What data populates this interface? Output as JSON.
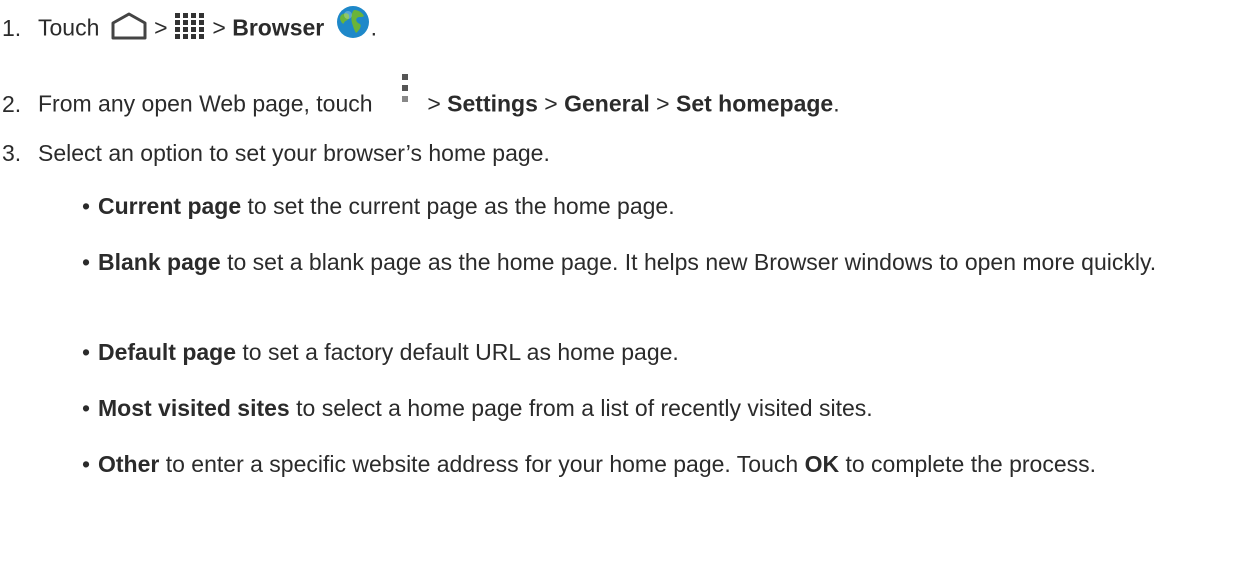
{
  "colors": {
    "text": "#2b2b2b",
    "icon_gray": "#444444",
    "globe_blue": "#1e88c9",
    "globe_green": "#6ab43a"
  },
  "icons": {
    "home": "home-outline-icon",
    "apps": "apps-grid-icon",
    "browser": "globe-icon",
    "menu": "overflow-menu-icon"
  },
  "steps": [
    {
      "num": "1.",
      "t1": "Touch",
      "sep1": " > ",
      "sep2": " > ",
      "b1": "Browser",
      "end": "."
    },
    {
      "num": "2.",
      "t1": "From any open Web page, touch",
      "sep1": " > ",
      "b1": "Settings",
      "sep2": " > ",
      "b2": "General",
      "sep3": " > ",
      "b3": "Set homepage",
      "end": "."
    },
    {
      "num": "3.",
      "t1": "Select an option to set your browser’s home page."
    }
  ],
  "options": [
    {
      "bullet": "•",
      "label": "Current page",
      "text": " to set the current page as the home page."
    },
    {
      "bullet": "•",
      "label": "Blank page",
      "text": " to set a blank page as the home page. It helps new Browser windows to open more quickly."
    },
    {
      "bullet": "•",
      "label": "Default page",
      "text": " to set a factory default URL as home page."
    },
    {
      "bullet": "•",
      "label": "Most visited sites",
      "text": " to select a home page from a list of recently visited sites."
    },
    {
      "bullet": "•",
      "label": "Other",
      "text": " to enter a specific website address for your home page. Touch ",
      "bold2": "OK",
      "text2": " to complete the process."
    }
  ]
}
